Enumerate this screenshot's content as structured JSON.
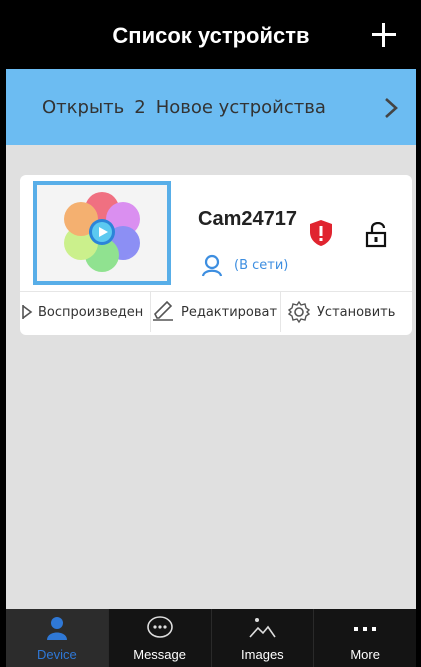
{
  "header": {
    "title": "Список устройств",
    "add_icon": "plus-icon"
  },
  "banner": {
    "prefix": "Открыть",
    "count": "2",
    "suffix": "Новое устройства",
    "chevron_icon": "chevron-right-icon"
  },
  "device": {
    "name": "Cam24717",
    "status": "(В сети)",
    "status_color": "#3d8ee0",
    "warning_icon": "shield-warning-icon",
    "lock_icon": "unlock-icon",
    "actions": [
      {
        "label": "Воспроизведен",
        "icon": "play-icon"
      },
      {
        "label": "Редактироват",
        "icon": "edit-icon"
      },
      {
        "label": "Установить",
        "icon": "gear-icon"
      }
    ]
  },
  "bottom_nav": {
    "items": [
      {
        "label": "Device",
        "icon": "person-icon",
        "active": true
      },
      {
        "label": "Message",
        "icon": "message-icon",
        "active": false
      },
      {
        "label": "Images",
        "icon": "image-icon",
        "active": false
      },
      {
        "label": "More",
        "icon": "more-icon",
        "active": false
      }
    ],
    "active_color": "#2f78d6"
  },
  "colors": {
    "banner": "#6cbcf2",
    "accent": "#58aee8",
    "background": "#e0e0e0"
  }
}
